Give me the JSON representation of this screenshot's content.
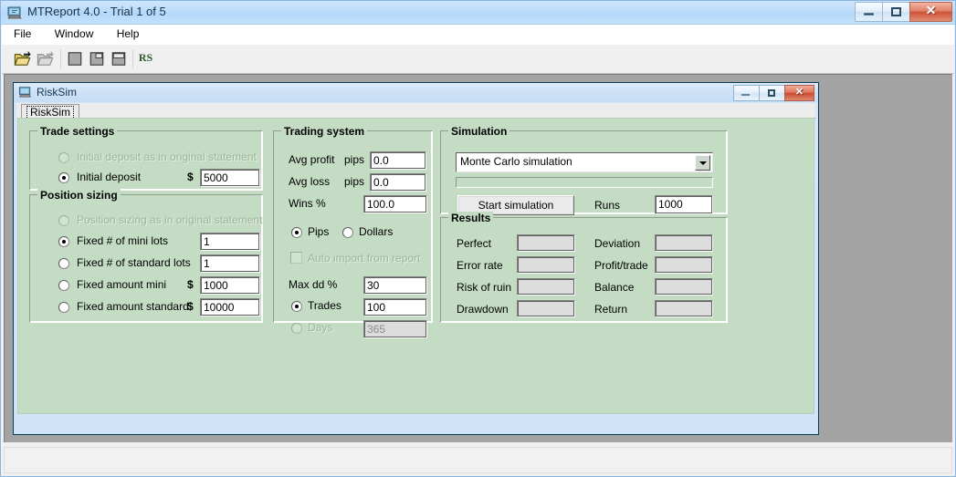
{
  "app": {
    "title": "MTReport 4.0 - Trial 1 of 5",
    "icon": "app-report-icon",
    "window_buttons": {
      "minimize": "Minimize",
      "maximize": "Maximize",
      "close": "Close",
      "close_glyph": "✕"
    }
  },
  "menu": {
    "items": [
      {
        "label": "File"
      },
      {
        "label": "Window"
      },
      {
        "label": "Help"
      }
    ]
  },
  "toolbar": {
    "buttons": [
      {
        "name": "open-file-button",
        "icon": "open-folder-icon",
        "enabled": true
      },
      {
        "name": "save-file-button",
        "icon": "save-folder-icon",
        "enabled": false
      },
      {
        "name": "close-window-button",
        "icon": "window-close-icon",
        "enabled": true
      },
      {
        "name": "cascade-windows-button",
        "icon": "cascade-windows-icon",
        "enabled": true
      },
      {
        "name": "tile-windows-button",
        "icon": "tile-windows-icon",
        "enabled": true
      },
      {
        "name": "risksim-button",
        "label": "RS",
        "enabled": true
      }
    ]
  },
  "child_window": {
    "title": "RiskSim",
    "icon": "risksim-icon",
    "window_buttons": {
      "minimize": "Minimize",
      "maximize": "Maximize",
      "close": "Close",
      "close_glyph": "✕"
    },
    "tabs": [
      {
        "label": "RiskSim",
        "selected": true
      }
    ]
  },
  "trade_settings": {
    "title": "Trade settings",
    "options": [
      {
        "label": "Initial deposit as in original statement",
        "checked": false,
        "enabled": false
      },
      {
        "label": "Initial deposit",
        "checked": true,
        "enabled": true
      }
    ],
    "initial_deposit": {
      "currency_symbol": "$",
      "value": "5000"
    }
  },
  "position_sizing": {
    "title": "Position sizing",
    "options": [
      {
        "label": "Position sizing as in original statement",
        "checked": false,
        "enabled": false,
        "value": "",
        "currency_symbol": ""
      },
      {
        "label": "Fixed # of mini lots",
        "checked": true,
        "enabled": true,
        "value": "1",
        "currency_symbol": ""
      },
      {
        "label": "Fixed # of standard lots",
        "checked": false,
        "enabled": true,
        "value": "1",
        "currency_symbol": ""
      },
      {
        "label": "Fixed amount mini",
        "checked": false,
        "enabled": true,
        "value": "1000",
        "currency_symbol": "$"
      },
      {
        "label": "Fixed amount standard",
        "checked": false,
        "enabled": true,
        "value": "10000",
        "currency_symbol": "$"
      }
    ]
  },
  "trading_system": {
    "title": "Trading system",
    "avg_profit": {
      "label": "Avg profit",
      "unit": "pips",
      "value": "0.0"
    },
    "avg_loss": {
      "label": "Avg loss",
      "unit": "pips",
      "value": "0.0"
    },
    "wins_pct": {
      "label": "Wins %",
      "value": "100.0"
    },
    "unit_options": [
      {
        "label": "Pips",
        "checked": true,
        "enabled": true
      },
      {
        "label": "Dollars",
        "checked": false,
        "enabled": true
      }
    ],
    "auto_import": {
      "label": "Auto import from report",
      "checked": false,
      "enabled": false
    },
    "max_dd": {
      "label": "Max dd %",
      "value": "30"
    },
    "duration_options": [
      {
        "label": "Trades",
        "checked": true,
        "enabled": true,
        "value": "100"
      },
      {
        "label": "Days",
        "checked": false,
        "enabled": false,
        "value": "365"
      }
    ]
  },
  "simulation": {
    "title": "Simulation",
    "mode": {
      "selected": "Monte Carlo simulation",
      "options": [
        "Monte Carlo simulation"
      ]
    },
    "progress_value": 0,
    "start_button": "Start simulation",
    "runs": {
      "label": "Runs",
      "value": "1000"
    }
  },
  "results": {
    "title": "Results",
    "fields": [
      {
        "label": "Perfect",
        "value": ""
      },
      {
        "label": "Deviation",
        "value": ""
      },
      {
        "label": "Error rate",
        "value": ""
      },
      {
        "label": "Profit/trade",
        "value": ""
      },
      {
        "label": "Risk of ruin",
        "value": ""
      },
      {
        "label": "Balance",
        "value": ""
      },
      {
        "label": "Drawdown",
        "value": ""
      },
      {
        "label": "Return",
        "value": ""
      }
    ]
  },
  "colors": {
    "panel_green": "#c3dcc3",
    "titlebar_blue": "#bcdcfa",
    "mdi_gray": "#a3a3a3",
    "close_red": "#cf5236"
  }
}
